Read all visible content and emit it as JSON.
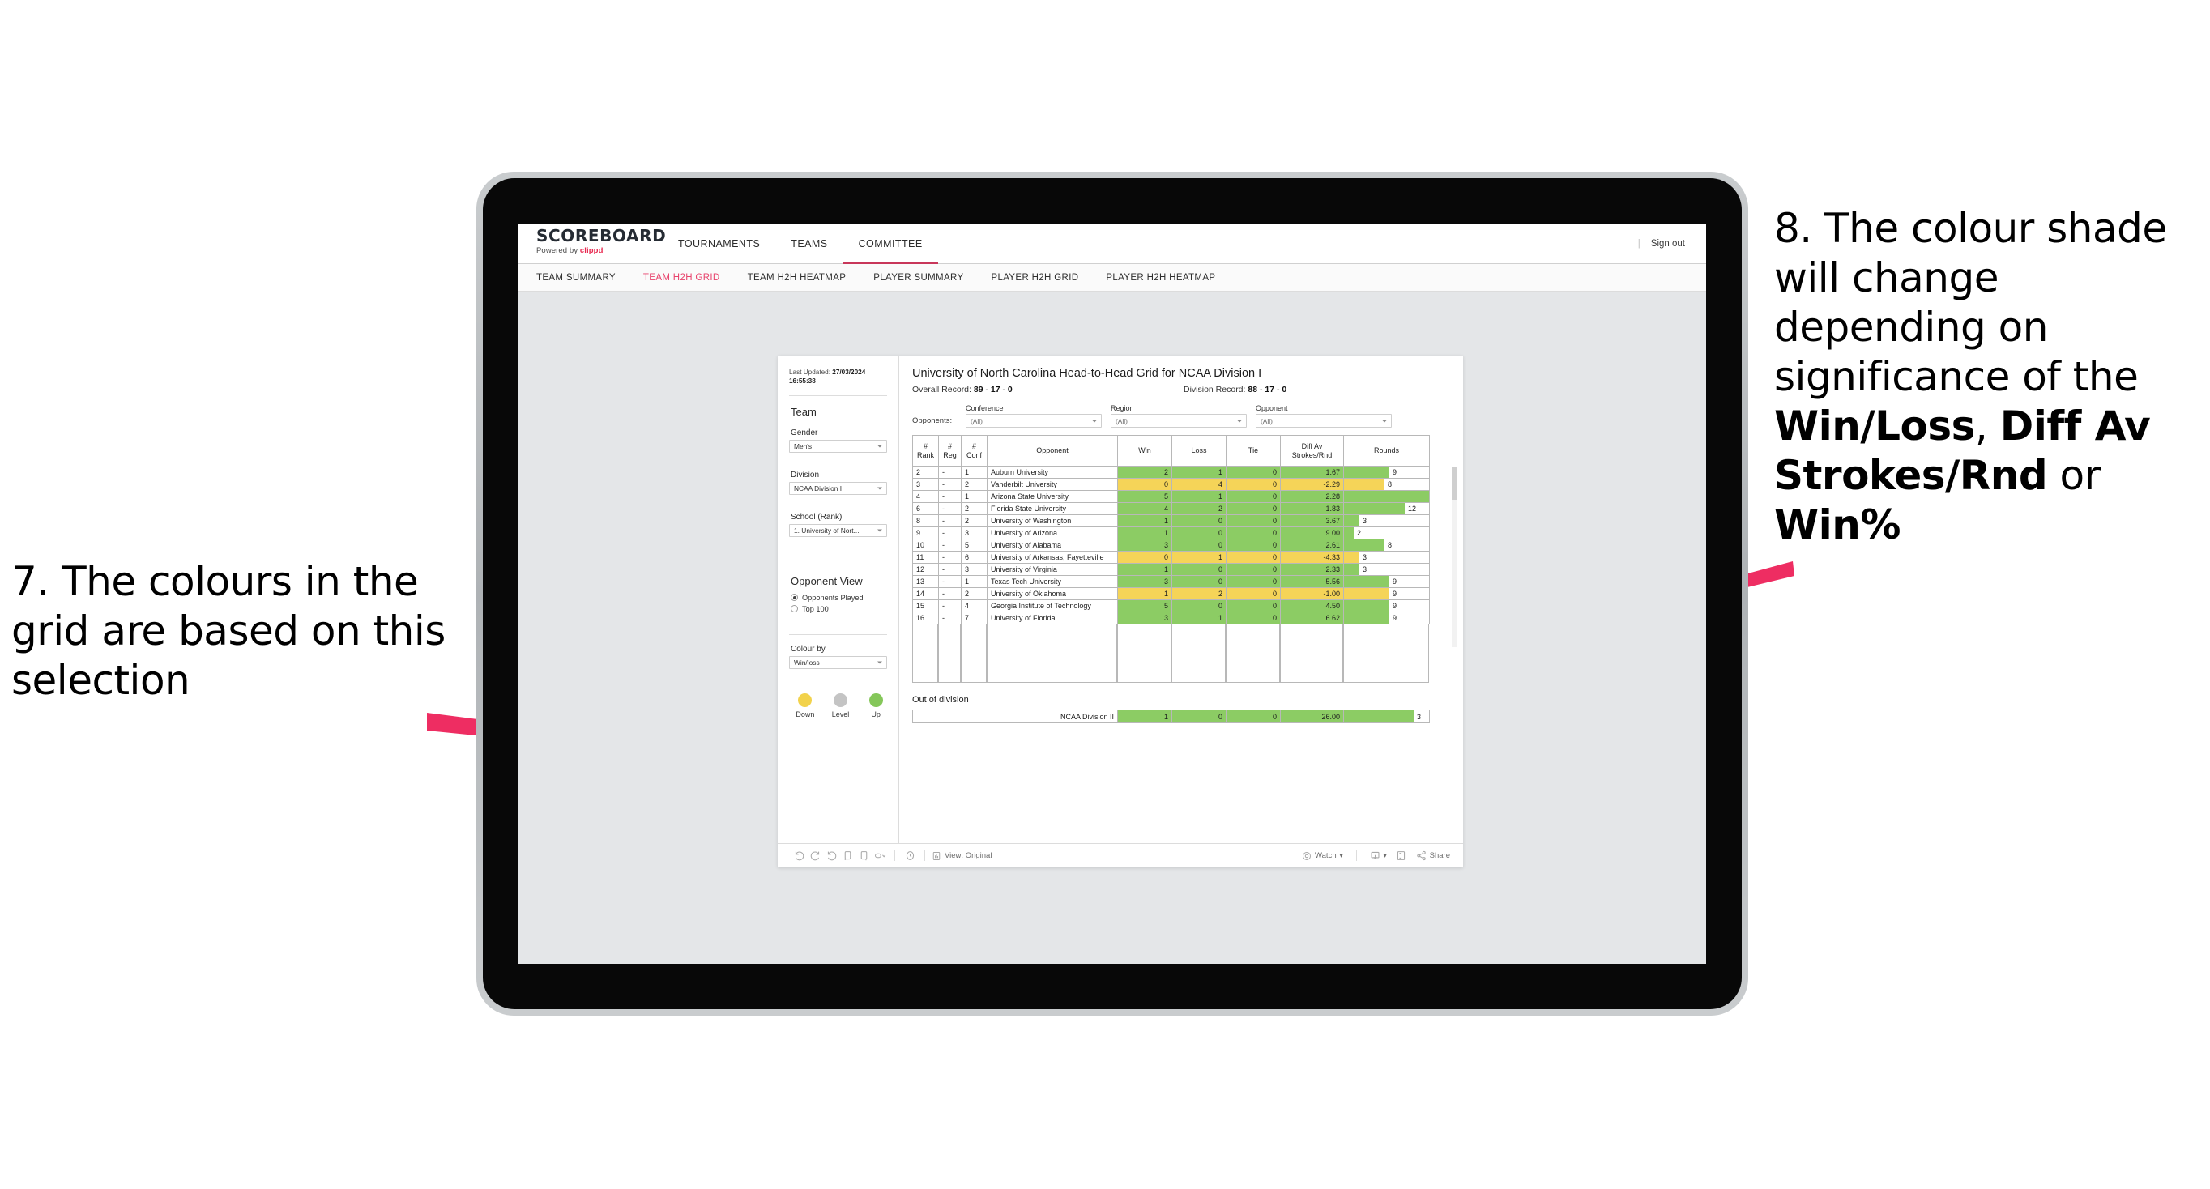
{
  "annotations": {
    "left": {
      "number": "7.",
      "text": "The colours in the grid are based on this selection"
    },
    "right": {
      "number": "8.",
      "line1": "The colour shade will change depending on significance of the",
      "bold1": "Win/Loss",
      "sep1": ", ",
      "bold2": "Diff Av Strokes/Rnd",
      "sep2": " or ",
      "bold3": "Win%"
    },
    "accent_color": "#EE2D62"
  },
  "app": {
    "brand_title": "SCOREBOARD",
    "brand_sub_prefix": "Powered by ",
    "brand_sub_name": "clippd",
    "signout_label": "Sign out",
    "signout_divider": "|",
    "topnav": [
      {
        "label": "TOURNAMENTS",
        "active": false
      },
      {
        "label": "TEAMS",
        "active": false
      },
      {
        "label": "COMMITTEE",
        "active": true
      }
    ],
    "subnav": [
      {
        "label": "TEAM SUMMARY",
        "active": false
      },
      {
        "label": "TEAM H2H GRID",
        "active": true
      },
      {
        "label": "TEAM H2H HEATMAP",
        "active": false
      },
      {
        "label": "PLAYER SUMMARY",
        "active": false
      },
      {
        "label": "PLAYER H2H GRID",
        "active": false
      },
      {
        "label": "PLAYER H2H HEATMAP",
        "active": false
      }
    ],
    "accent_color": "#E8436C"
  },
  "sidebar": {
    "last_updated_label": "Last Updated: ",
    "last_updated_value": "27/03/2024 16:55:38",
    "team_heading": "Team",
    "gender_label": "Gender",
    "gender_value": "Men's",
    "division_label": "Division",
    "division_value": "NCAA Division I",
    "school_label": "School (Rank)",
    "school_value": "1. University of Nort...",
    "opponent_view_heading": "Opponent View",
    "opponent_view_options": [
      {
        "label": "Opponents Played",
        "selected": true
      },
      {
        "label": "Top 100",
        "selected": false
      }
    ],
    "colour_by_label": "Colour by",
    "colour_by_value": "Win/loss",
    "legend": [
      {
        "label": "Down",
        "color": "#F2D24B"
      },
      {
        "label": "Level",
        "color": "#C4C4C4"
      },
      {
        "label": "Up",
        "color": "#85C75A"
      }
    ]
  },
  "main": {
    "title": "University of North Carolina Head-to-Head Grid for NCAA Division I",
    "overall_record_label": "Overall Record: ",
    "overall_record_value": "89 - 17 - 0",
    "division_record_label": "Division Record: ",
    "division_record_value": "88 - 17 - 0",
    "opponents_label": "Opponents:",
    "filters": [
      {
        "label": "Conference",
        "value": "(All)"
      },
      {
        "label": "Region",
        "value": "(All)"
      },
      {
        "label": "Opponent",
        "value": "(All)"
      }
    ],
    "out_of_division_title": "Out of division"
  },
  "chart_data": {
    "type": "table",
    "title": "University of North Carolina Head-to-Head Grid for NCAA Division I",
    "columns": [
      "# Rank",
      "# Reg",
      "# Conf",
      "Opponent",
      "Win",
      "Loss",
      "Tie",
      "Diff Av Strokes/Rnd",
      "Rounds"
    ],
    "header_lines": [
      [
        "#",
        "Rank"
      ],
      [
        "#",
        "Reg"
      ],
      [
        "#",
        "Conf"
      ],
      [
        "Opponent"
      ],
      [
        "Win"
      ],
      [
        "Loss"
      ],
      [
        "Tie"
      ],
      [
        "Diff Av",
        "Strokes/Rnd"
      ],
      [
        "Rounds"
      ]
    ],
    "rounds_max": 17,
    "rows": [
      {
        "rank": "2",
        "reg": "-",
        "conf": "1",
        "opponent": "Auburn University",
        "win": "2",
        "loss": "1",
        "tie": "0",
        "diff": "1.67",
        "rounds": "9",
        "color": "green"
      },
      {
        "rank": "3",
        "reg": "-",
        "conf": "2",
        "opponent": "Vanderbilt University",
        "win": "0",
        "loss": "4",
        "tie": "0",
        "diff": "-2.29",
        "rounds": "8",
        "color": "yellow"
      },
      {
        "rank": "4",
        "reg": "-",
        "conf": "1",
        "opponent": "Arizona State University",
        "win": "5",
        "loss": "1",
        "tie": "0",
        "diff": "2.28",
        "rounds": "17",
        "color": "green"
      },
      {
        "rank": "6",
        "reg": "-",
        "conf": "2",
        "opponent": "Florida State University",
        "win": "4",
        "loss": "2",
        "tie": "0",
        "diff": "1.83",
        "rounds": "12",
        "color": "green"
      },
      {
        "rank": "8",
        "reg": "-",
        "conf": "2",
        "opponent": "University of Washington",
        "win": "1",
        "loss": "0",
        "tie": "0",
        "diff": "3.67",
        "rounds": "3",
        "color": "green"
      },
      {
        "rank": "9",
        "reg": "-",
        "conf": "3",
        "opponent": "University of Arizona",
        "win": "1",
        "loss": "0",
        "tie": "0",
        "diff": "9.00",
        "rounds": "2",
        "color": "green"
      },
      {
        "rank": "10",
        "reg": "-",
        "conf": "5",
        "opponent": "University of Alabama",
        "win": "3",
        "loss": "0",
        "tie": "0",
        "diff": "2.61",
        "rounds": "8",
        "color": "green"
      },
      {
        "rank": "11",
        "reg": "-",
        "conf": "6",
        "opponent": "University of Arkansas, Fayetteville",
        "win": "0",
        "loss": "1",
        "tie": "0",
        "diff": "-4.33",
        "rounds": "3",
        "color": "yellow"
      },
      {
        "rank": "12",
        "reg": "-",
        "conf": "3",
        "opponent": "University of Virginia",
        "win": "1",
        "loss": "0",
        "tie": "0",
        "diff": "2.33",
        "rounds": "3",
        "color": "green"
      },
      {
        "rank": "13",
        "reg": "-",
        "conf": "1",
        "opponent": "Texas Tech University",
        "win": "3",
        "loss": "0",
        "tie": "0",
        "diff": "5.56",
        "rounds": "9",
        "color": "green"
      },
      {
        "rank": "14",
        "reg": "-",
        "conf": "2",
        "opponent": "University of Oklahoma",
        "win": "1",
        "loss": "2",
        "tie": "0",
        "diff": "-1.00",
        "rounds": "9",
        "color": "yellow"
      },
      {
        "rank": "15",
        "reg": "-",
        "conf": "4",
        "opponent": "Georgia Institute of Technology",
        "win": "5",
        "loss": "0",
        "tie": "0",
        "diff": "4.50",
        "rounds": "9",
        "color": "green"
      },
      {
        "rank": "16",
        "reg": "-",
        "conf": "7",
        "opponent": "University of Florida",
        "win": "3",
        "loss": "1",
        "tie": "0",
        "diff": "6.62",
        "rounds": "9",
        "color": "green"
      }
    ],
    "out_of_division": [
      {
        "name": "NCAA Division II",
        "win": "1",
        "loss": "0",
        "tie": "0",
        "diff": "26.00",
        "rounds": "3",
        "color": "green"
      }
    ],
    "color_map": {
      "green": "#8CCC64",
      "yellow": "#F5D458"
    }
  },
  "toolbar": {
    "view_label": "View: Original",
    "watch_label": "Watch",
    "share_label": "Share"
  }
}
